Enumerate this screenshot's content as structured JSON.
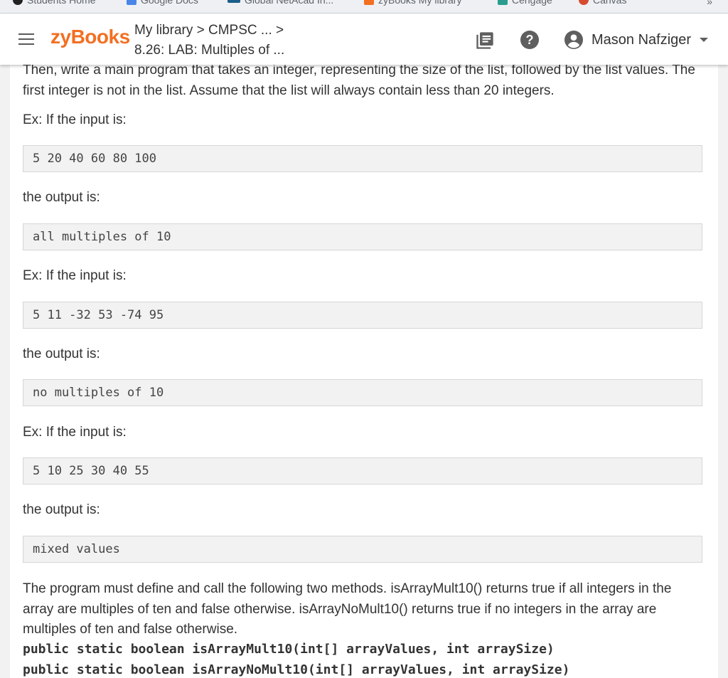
{
  "bookmarks": {
    "items": [
      {
        "label": "Students Home"
      },
      {
        "label": "Google Docs"
      },
      {
        "label": "Global NetAcad In..."
      },
      {
        "label": "zyBooks My library"
      },
      {
        "label": "Cengage"
      },
      {
        "label": "Canvas"
      }
    ],
    "more": "»"
  },
  "header": {
    "logo": "zyBooks",
    "breadcrumb_line1": "My library > CMPSC ... >",
    "breadcrumb_line2": "8.26: LAB: Multiples of ...",
    "help": "?",
    "user_name": "Mason Nafziger"
  },
  "content": {
    "intro": "Then, write a main program that takes an integer, representing the size of the list, followed by the list values. The first integer is not in the list. Assume that the list will always contain less than 20 integers.",
    "examples": [
      {
        "input_label": "Ex: If the input is:",
        "input": "5 20 40 60 80 100",
        "output_label": "the output is:",
        "output": "all multiples of 10"
      },
      {
        "input_label": "Ex: If the input is:",
        "input": "5 11 -32 53 -74 95",
        "output_label": "the output is:",
        "output": "no multiples of 10"
      },
      {
        "input_label": "Ex: If the input is:",
        "input": "5 10 25 30 40 55",
        "output_label": "the output is:",
        "output": "mixed values"
      }
    ],
    "methods_text": "The program must define and call the following two methods. isArrayMult10() returns true if all integers in the array are multiples of ten and false otherwise. isArrayNoMult10() returns true if no integers in the array are multiples of ten and false otherwise.",
    "signatures": [
      "public static boolean isArrayMult10(int[] arrayValues, int arraySize)",
      "public static boolean isArrayNoMult10(int[] arrayValues, int arraySize)"
    ]
  },
  "colors": {
    "brand": "#f36f21",
    "code_bg": "#f2f2f2"
  }
}
